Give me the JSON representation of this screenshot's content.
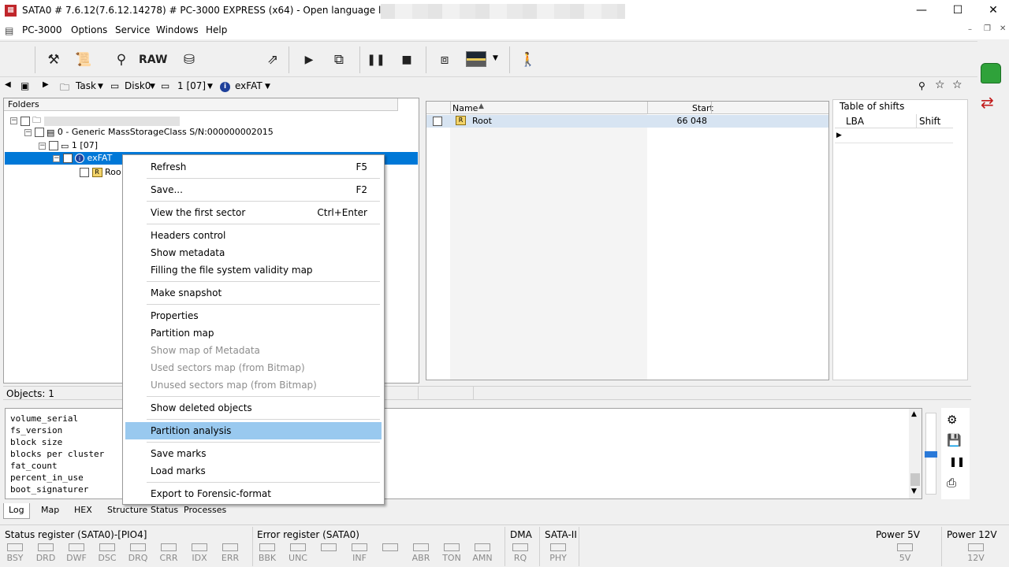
{
  "window": {
    "title": "SATA0 # 7.6.12(7.6.12.14278) # PC-3000 EXPRESS (x64) - Open language license -",
    "minimize": "—",
    "maximize": "☐",
    "close": "✕"
  },
  "menubar": {
    "app": "PC-3000",
    "items": [
      "Options",
      "Service",
      "Windows",
      "Help"
    ]
  },
  "toolbar": {
    "raw_label": "RAW"
  },
  "pathbar": {
    "task": "Task",
    "disk": "Disk0",
    "partition": "1 [07]",
    "fs": "exFAT"
  },
  "folders": {
    "header": "Folders",
    "nodes": [
      {
        "label": "0 - Generic MassStorageClass  S/N:000000002015"
      },
      {
        "label": "1 [07]"
      },
      {
        "label": "exFAT"
      },
      {
        "label": "Roo"
      }
    ]
  },
  "filelist": {
    "col_name": "Name",
    "col_start": "Start",
    "rows": [
      {
        "name": "Root",
        "start": "66 048"
      }
    ]
  },
  "shifts": {
    "title": "Table of shifts",
    "col_lba": "LBA",
    "col_shift": "Shift"
  },
  "objects_count": "Objects: 1",
  "context_menu": {
    "items": [
      {
        "label": "Refresh",
        "shortcut": "F5"
      },
      {
        "label": "Save...",
        "shortcut": "F2"
      },
      {
        "label": "View the first sector",
        "shortcut": "Ctrl+Enter"
      },
      {
        "label": "Headers control",
        "shortcut": ""
      },
      {
        "label": "Show metadata",
        "shortcut": ""
      },
      {
        "label": "Filling the file system validity map",
        "shortcut": ""
      },
      {
        "label": "Make snapshot",
        "shortcut": ""
      },
      {
        "label": "Properties",
        "shortcut": ""
      },
      {
        "label": "Partition map",
        "shortcut": ""
      },
      {
        "label": "Show map of Metadata",
        "shortcut": ""
      },
      {
        "label": "Used sectors map (from Bitmap)",
        "shortcut": ""
      },
      {
        "label": "Unused sectors map (from Bitmap)",
        "shortcut": ""
      },
      {
        "label": "Show deleted objects",
        "shortcut": ""
      },
      {
        "label": "Partition analysis",
        "shortcut": ""
      },
      {
        "label": "Save marks",
        "shortcut": ""
      },
      {
        "label": "Load marks",
        "shortcut": ""
      },
      {
        "label": "Export to Forensic-format",
        "shortcut": ""
      }
    ]
  },
  "log": {
    "lines": [
      "volume_serial",
      "fs_version",
      "block size",
      "blocks per cluster",
      "fat_count",
      "percent_in_use",
      "boot_signaturer"
    ]
  },
  "bottom_tabs": [
    "Log",
    "Map",
    "HEX",
    "Structure",
    "Status",
    "Processes"
  ],
  "status": {
    "status_register": "Status register (SATA0)-[PIO4]",
    "status_bits": [
      "BSY",
      "DRD",
      "DWF",
      "DSC",
      "DRQ",
      "CRR",
      "IDX",
      "ERR"
    ],
    "error_register": "Error register (SATA0)",
    "error_bits": [
      "BBK",
      "UNC",
      "",
      "INF",
      "",
      "ABR",
      "TON",
      "AMN"
    ],
    "dma": "DMA",
    "dma_bit": "RQ",
    "sata": "SATA-II",
    "sata_bit": "PHY",
    "power5": "Power 5V",
    "power5_bit": "5V",
    "power12": "Power 12V",
    "power12_bit": "12V"
  }
}
